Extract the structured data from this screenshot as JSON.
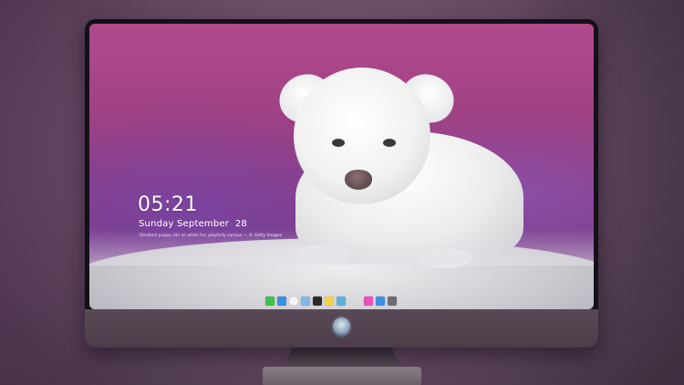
{
  "lockscreen": {
    "time": "05:21",
    "date": "Sunday September  28",
    "caption": "Smallest puppy sits on white fur, playfully curious — © Getty Images"
  },
  "dock": {
    "left_apps": [
      {
        "icon": "messages-icon",
        "color": "#3cc04a"
      },
      {
        "icon": "finder-icon",
        "color": "#3a8fe0"
      },
      {
        "icon": "clock-icon",
        "color": "#f4f4f4"
      },
      {
        "icon": "preview-icon",
        "color": "#7fb8e6"
      },
      {
        "icon": "video-icon",
        "color": "#2b2b2b"
      },
      {
        "icon": "notes-icon",
        "color": "#f3d14a"
      },
      {
        "icon": "photos-icon",
        "color": "#5fb0d8"
      }
    ],
    "right_apps": [
      {
        "icon": "music-icon",
        "color": "#e652b8"
      },
      {
        "icon": "app-store-icon",
        "color": "#3a8fe0"
      },
      {
        "icon": "camera-icon",
        "color": "#6d6d73"
      }
    ]
  }
}
